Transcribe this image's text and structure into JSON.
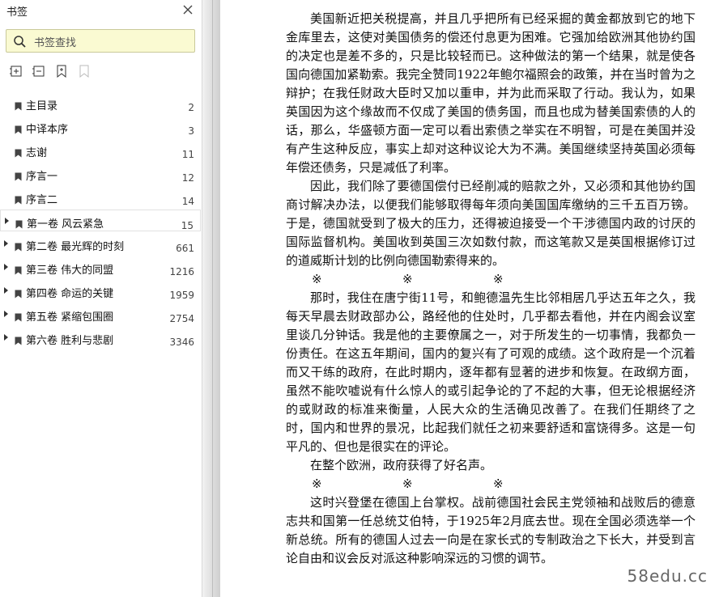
{
  "sidebar": {
    "title": "书签",
    "search_placeholder": "书签查找",
    "toolbar": [
      "expand-all-icon",
      "collapse-all-icon",
      "add-bookmark-icon",
      "delete-bookmark-icon"
    ],
    "items": [
      {
        "label": "主目录",
        "page": "2",
        "expandable": false,
        "selected": false
      },
      {
        "label": "中译本序",
        "page": "3",
        "expandable": false,
        "selected": false
      },
      {
        "label": "志谢",
        "page": "11",
        "expandable": false,
        "selected": false
      },
      {
        "label": "序言一",
        "page": "12",
        "expandable": false,
        "selected": false
      },
      {
        "label": "序言二",
        "page": "14",
        "expandable": false,
        "selected": false
      },
      {
        "label": "第一卷 风云紧急",
        "page": "15",
        "expandable": true,
        "selected": true
      },
      {
        "label": "第二卷 最光辉的时刻",
        "page": "661",
        "expandable": true,
        "selected": false
      },
      {
        "label": "第三卷 伟大的同盟",
        "page": "1216",
        "expandable": true,
        "selected": false
      },
      {
        "label": "第四卷 命运的关键",
        "page": "1959",
        "expandable": true,
        "selected": false
      },
      {
        "label": "第五卷 紧缩包围圈",
        "page": "2754",
        "expandable": true,
        "selected": false
      },
      {
        "label": "第六卷 胜利与悲剧",
        "page": "3346",
        "expandable": true,
        "selected": false
      }
    ]
  },
  "document": {
    "paragraphs": [
      "美国新近把关税提高，并且几乎把所有已经采掘的黄金都放到它的地下金库里去，这使对美国债务的偿还付息更为困难。它强加给欧洲其他协约国的决定也是差不多的，只是比较轻而已。这种做法的第一个结果，就是使各国向德国加紧勒索。我完全赞同1922年鲍尔福照会的政策，并在当时曾为之辩护；在我任财政大臣时又加以重申，并为此而采取了行动。我认为，如果英国因为这个缘故而不仅成了美国的债务国，而且也成为替美国索债的人的话，那么，华盛顿方面一定可以看出索债之举实在不明智，可是在美国并没有产生这种反应，事实上却对这种议论大为不满。美国继续坚持英国必须每年偿还债务，只是减低了利率。",
      "因此，我们除了要德国偿付已经削减的赔款之外，又必须和其他协约国商讨解决办法，以便我们能够取得每年须向美国国库缴纳的三千五百万镑。于是，德国就受到了极大的压力，还得被迫接受一个干涉德国内政的讨厌的国际监督机构。美国收到英国三次如数付款，而这笔款又是英国根据修订过的道威斯计划的比例向德国勒索得来的。",
      "那时，我住在唐宁街11号，和鲍德温先生比邻相居几乎达五年之久，我每天早晨去财政部办公，路经他的住处时，几乎都去看他，并在内阁会议室里谈几分钟话。我是他的主要僚属之一，对于所发生的一切事情，我都负一份责任。在这五年期间，国内的复兴有了可观的成绩。这个政府是一个沉着而又干练的政府，在此时期内，逐年都有显著的进步和恢复。在政纲方面，虽然不能吹嘘说有什么惊人的或引起争论的了不起的大事，但无论根据经济的或财政的标准来衡量，人民大众的生活确见改善了。在我们任期终了之时，国内和世界的景况，比起我们就任之初来要舒适和富饶得多。这是一句平凡的、但也是很实在的评论。",
      "在整个欧洲，政府获得了好名声。",
      "这时兴登堡在德国上台掌权。战前德国社会民主党领袖和战败后的德意志共和国第一任总统艾伯特，于1925年2月底去世。现在全国必须选举一个新总统。所有的德国人过去一向是在家长式的专制政治之下长大，并受到言论自由和议会反对派这种影响深远的习惯的调节。"
    ],
    "separator": "※"
  },
  "watermark": "58edu.cc"
}
